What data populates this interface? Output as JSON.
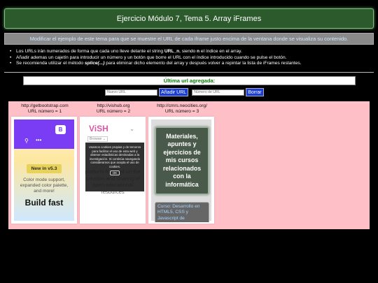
{
  "header": {
    "title": "Ejercicio Módulo 7, Tema 5. Array iFrames",
    "description": "Modificar el ejemplo de este tema para que se muestre el URL de cada iframe justo encima de la ventana donde se visualiza su contenido."
  },
  "instructions": [
    {
      "pre": "Los URLs irán numerados de forma que cada uno lleve delante el string ",
      "b1": "URL_n",
      "mid": ", siendo ",
      "b2": "n",
      "post": " el índice en el array."
    },
    {
      "text": "Añadir ademas un cajetín para introducir un número y un botón que borre el URL con el índice introducido cuando se pulse el botón."
    },
    {
      "pre": "Se recomienda utilizar el método ",
      "b1": "splice(...)",
      "post": " para eliminar dicho elemento del array y después volver a repintar la lista de iFrames restantes."
    }
  ],
  "last_url": {
    "label": "Última url agregada:"
  },
  "controls": {
    "url_placeholder": "Nuevo URL",
    "add_button": "Añadir URL",
    "number_placeholder": "Número de URL",
    "delete_button": "Borrar"
  },
  "frames": [
    {
      "url": "http://getbootstrap.com",
      "label": "URL número = 1",
      "content": {
        "badge": "New in v5.3",
        "text": "Color mode support, expanded color palette, and more!",
        "heading": "Build fast"
      }
    },
    {
      "url": "http://vishub.org",
      "label": "URL número = 2",
      "content": {
        "logo": "ViSH",
        "browse": "Browse",
        "body": "platform focused on the creation and sharing of open educational resources",
        "cookie": "Usamos cookies propias y de terceros para facilitar el uso de esta web y obtener estadísticas destinadas a la investigación. Si continúa navegando consideramos que acepta el uso de cookies.",
        "ok": "OK"
      }
    },
    {
      "url": "http://cmrs.neocities.org/",
      "label": "URL número = 3",
      "content": {
        "card": "Materiales, apuntes y ejercicios de mis cursos relacionados con la informática",
        "link": "Curso: Desarrollo en HTML5, CSS y Javascript de"
      }
    }
  ],
  "colors": {
    "title_bg": "#2c5a2c",
    "panel_bg": "#ffbfc7",
    "button_bg": "#1a3fd0",
    "last_url_text": "#0a7a0a"
  }
}
